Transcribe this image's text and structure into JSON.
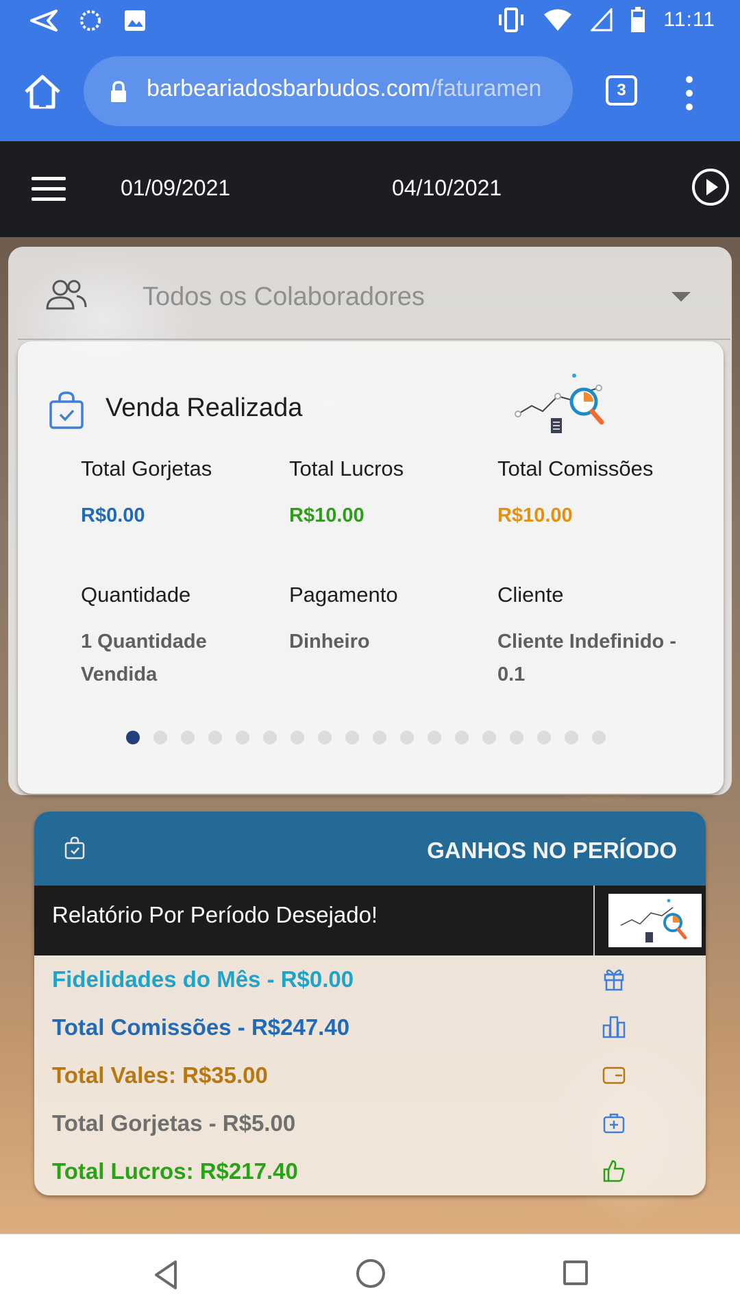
{
  "status_bar": {
    "time": "11:11",
    "icons": [
      "send-icon",
      "sync-icon",
      "image-icon",
      "vibrate-icon",
      "wifi-icon",
      "signal-icon",
      "battery-icon"
    ]
  },
  "browser": {
    "url_domain": "barbeariadosbarbudos.com",
    "url_path": "/faturamen",
    "tab_count": "3"
  },
  "header": {
    "date_start": "01/09/2021",
    "date_end": "04/10/2021"
  },
  "filter": {
    "collaborators": "Todos os Colaboradores"
  },
  "sale_card": {
    "title": "Venda Realizada",
    "fields": [
      {
        "label": "Total Gorjetas",
        "value": "R$0.00",
        "color": "#1f6bb9"
      },
      {
        "label": "Total Lucros",
        "value": "R$10.00",
        "color": "#2d9e1a"
      },
      {
        "label": "Total Comissões",
        "value": "R$10.00",
        "color": "#e58f0d"
      },
      {
        "label": "Quantidade",
        "value": "1 Quantidade Vendida",
        "color": "#5f5f5f"
      },
      {
        "label": "Pagamento",
        "value": "Dinheiro",
        "color": "#5f5f5f"
      },
      {
        "label": "Cliente",
        "value": "Cliente Indefinido - 0.1",
        "color": "#5f5f5f"
      }
    ],
    "pager_active": 1,
    "pager_total": 18
  },
  "earnings": {
    "title": "GANHOS NO PERÍODO",
    "subtitle": "Relatório Por Período Desejado!",
    "rows": [
      {
        "text": "Fidelidades do Mês - R$0.00",
        "icon": "gift-icon"
      },
      {
        "text": "Total Comissões - R$247.40",
        "icon": "bar-chart-icon"
      },
      {
        "text": "Total Vales: R$35.00",
        "icon": "wallet-icon"
      },
      {
        "text": "Total Gorjetas - R$5.00",
        "icon": "medical-bag-icon"
      },
      {
        "text": "Total Lucros: R$217.40",
        "icon": "thumbs-up-icon"
      }
    ]
  },
  "colors": {
    "browser_bar": "#3b7ae6",
    "app_header": "#1b1d20",
    "earnings_header": "#236a96"
  }
}
